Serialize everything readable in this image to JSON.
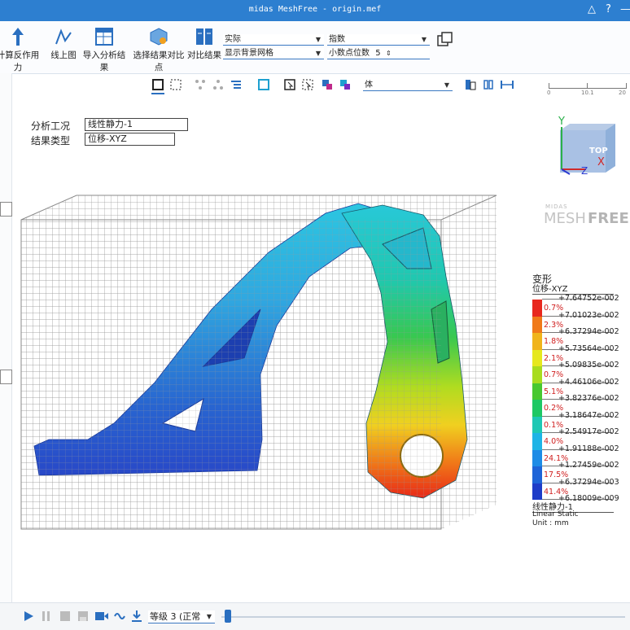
{
  "window": {
    "title": "midas MeshFree - origin.mef"
  },
  "ribbon": {
    "buttons": [
      {
        "label": "计算反作用力"
      },
      {
        "label": "线上图"
      },
      {
        "label": "导入分析结果"
      },
      {
        "label": "选择结果对比点"
      },
      {
        "label": "对比结果"
      }
    ],
    "combo_scale": "实际",
    "combo_background": "显示背景网格",
    "combo_format": "指数",
    "decimal_label": "小数点位数",
    "decimal_value": "5"
  },
  "view_toolbar": {
    "entity_select": "体"
  },
  "ruler": {
    "ticks": [
      "0",
      "10.1",
      "20"
    ]
  },
  "form": {
    "analysis_case_label": "分析工况",
    "analysis_case_value": "线性静力-1",
    "result_type_label": "结果类型",
    "result_type_value": "位移-XYZ"
  },
  "view_cube": {
    "y": "Y",
    "z": "Z",
    "x": "X",
    "face": "TOP"
  },
  "watermark": {
    "small": "MIDAS",
    "big_thin": "MESH",
    "big_bold": "FREE"
  },
  "legend": {
    "title": "变形",
    "subtitle": "位移-XYZ",
    "values": [
      "+7.64752e-002",
      "+7.01023e-002",
      "+6.37294e-002",
      "+5.73564e-002",
      "+5.09835e-002",
      "+4.46106e-002",
      "+3.82376e-002",
      "+3.18647e-002",
      "+2.54917e-002",
      "+1.91188e-002",
      "+1.27459e-002",
      "+6.37294e-003",
      "+6.18009e-009"
    ],
    "percents": [
      "0.7%",
      "2.3%",
      "1.8%",
      "2.1%",
      "0.7%",
      "5.1%",
      "0.2%",
      "0.1%",
      "4.0%",
      "24.1%",
      "17.5%",
      "41.4%"
    ],
    "colors": [
      "#e8281e",
      "#f07a1a",
      "#f0b41c",
      "#e6e81e",
      "#a8dc1e",
      "#48c830",
      "#1ec864",
      "#1ec8b4",
      "#1eb4e6",
      "#1e8ce6",
      "#1e64d8",
      "#1e3cc8"
    ],
    "case": "线性静力-1",
    "analysis": "Linear Static",
    "unit": "Unit : mm"
  },
  "statusbar": {
    "step_select": "等级 3 (正常"
  }
}
